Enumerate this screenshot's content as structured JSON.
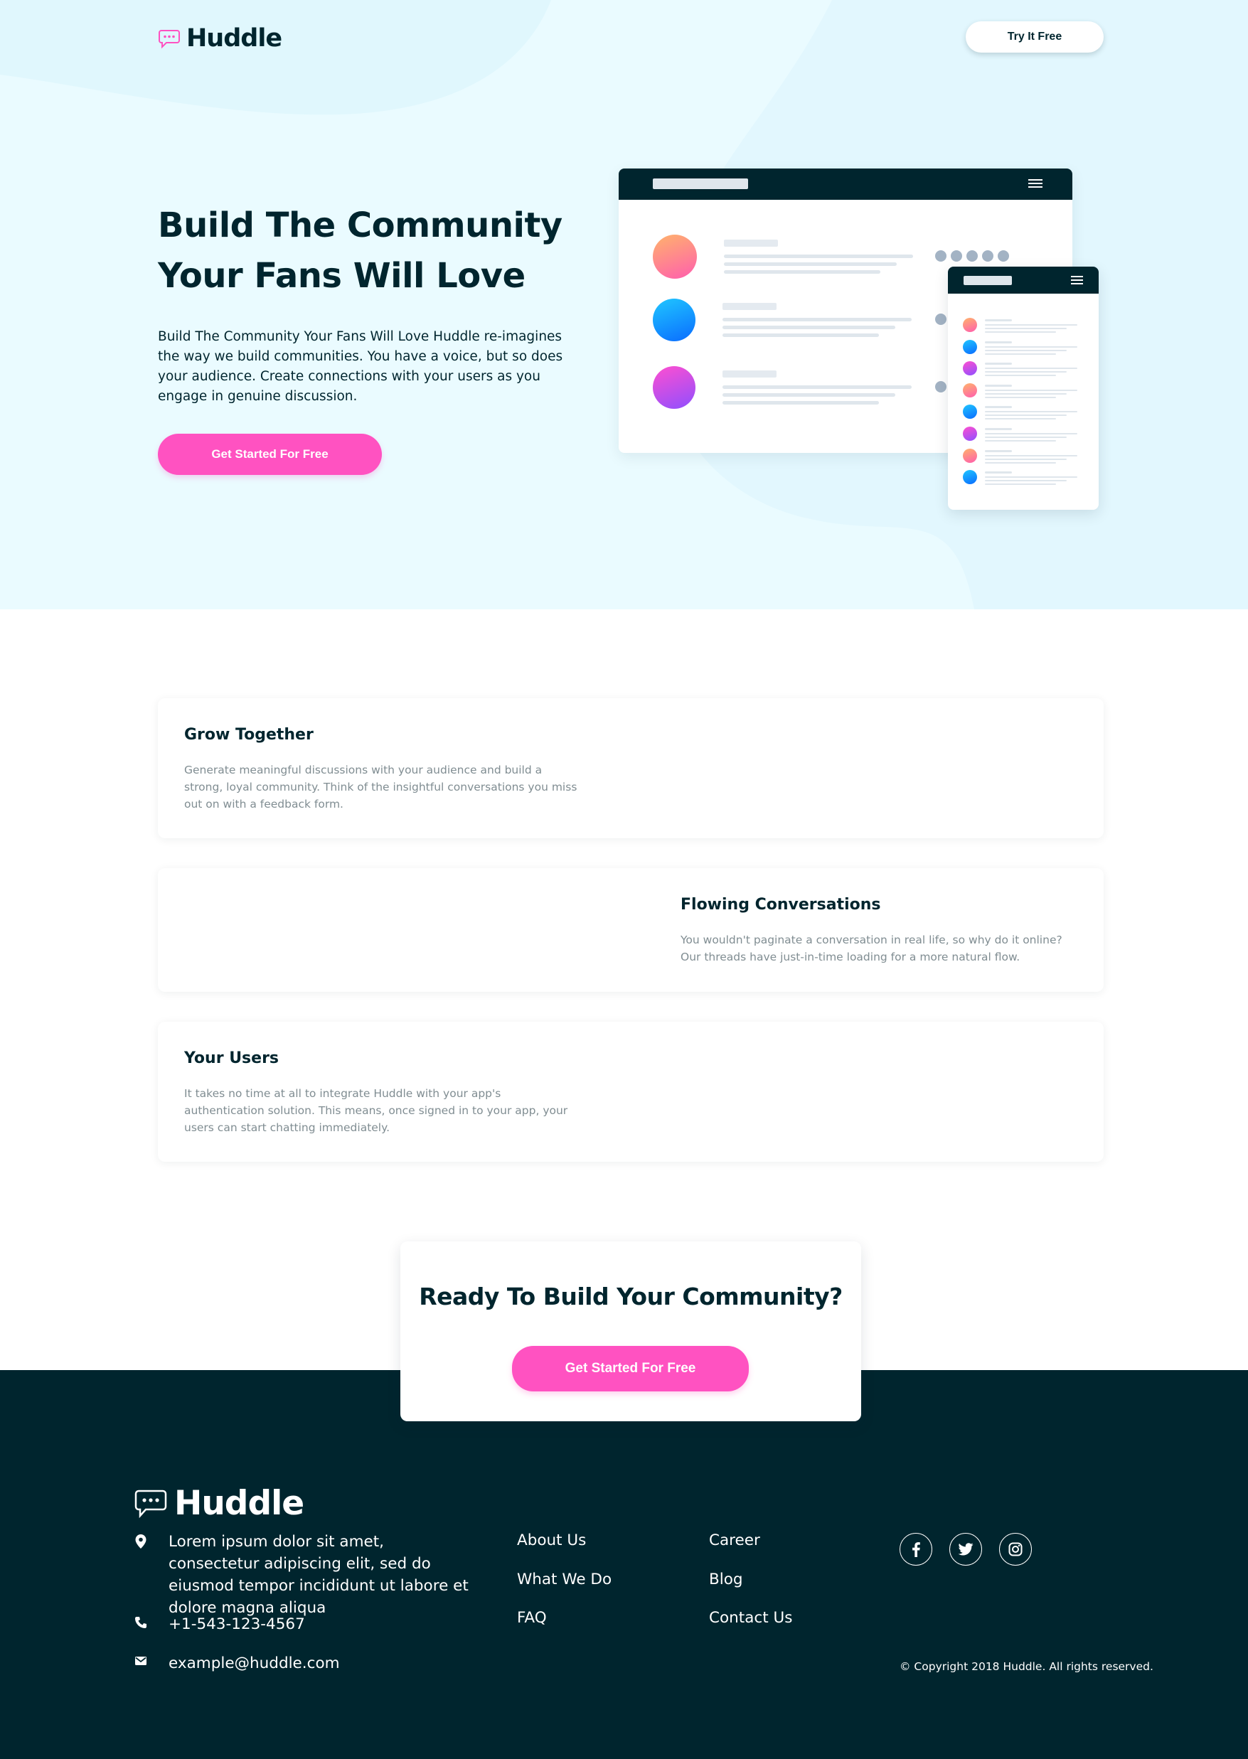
{
  "header": {
    "logo_text": "Huddle",
    "cta_label": "Try It Free"
  },
  "hero": {
    "title": "Build The Community Your Fans Will Love",
    "description": "Build The Community Your Fans Will Love Huddle re-imagines the way we build communities. You have a voice, but so does your audience. Create connections with your users as you engage in genuine discussion.",
    "cta_label": "Get Started For Free"
  },
  "features": [
    {
      "title": "Grow Together",
      "text": "Generate meaningful discussions with your audience and build a strong, loyal community. Think of the insightful conversations you miss out on with a feedback form."
    },
    {
      "title": "Flowing Conversations",
      "text": "You wouldn't paginate a conversation in real life, so why do it online? Our threads have just-in-time loading for a more natural flow."
    },
    {
      "title": "Your Users",
      "text": "It takes no time at all to integrate Huddle with your app's authentication solution. This means, once signed in to your app, your users can start chatting immediately."
    }
  ],
  "cta": {
    "title": "Ready To Build Your Community?",
    "button_label": "Get Started For Free"
  },
  "footer": {
    "logo_text": "Huddle",
    "address": "Lorem ipsum dolor sit amet, consectetur adipiscing elit, sed do eiusmod tempor incididunt ut labore et dolore magna aliqua",
    "phone": "+1-543-123-4567",
    "email": "example@huddle.com",
    "links_col1": [
      "About Us",
      "What We Do",
      "FAQ"
    ],
    "links_col2": [
      "Career",
      "Blog",
      "Contact Us"
    ],
    "social": [
      "facebook-icon",
      "twitter-icon",
      "instagram-icon"
    ],
    "copyright": "© Copyright 2018 Huddle. All rights reserved."
  },
  "colors": {
    "dark": "#00252e",
    "pink": "#ff52c1",
    "hero_bg": "#eafbff",
    "muted_text": "#808d92"
  }
}
